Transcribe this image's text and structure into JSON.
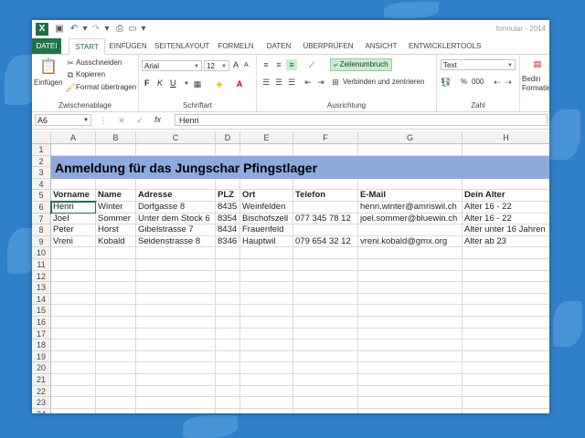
{
  "app": {
    "window_title": "formular - 2014",
    "tabs": [
      "DATEI",
      "START",
      "EINFÜGEN",
      "SEITENLAYOUT",
      "FORMELN",
      "DATEN",
      "ÜBERPRÜFEN",
      "ANSICHT",
      "ENTWICKLERTOOLS"
    ],
    "active_tab": "START"
  },
  "ribbon": {
    "clipboard": {
      "paste": "Einfügen",
      "cut": "Ausschneiden",
      "copy": "Kopieren",
      "format_painter": "Format übertragen",
      "label": "Zwischenablage"
    },
    "font": {
      "font_name": "Arial",
      "font_size": "12",
      "grow": "A",
      "shrink": "A",
      "bold": "F",
      "italic": "K",
      "underline": "U",
      "label": "Schriftart"
    },
    "alignment": {
      "wrap_text": "Zeilenumbruch",
      "merge_center": "Verbinden und zentrieren",
      "label": "Ausrichtung"
    },
    "number": {
      "format": "Text",
      "percent": "%",
      "thousands": "000",
      "label": "Zahl"
    },
    "styles": {
      "conditional": "Bedin",
      "conditional2": "Formatie"
    }
  },
  "formula_bar": {
    "name_box": "A6",
    "fx": "fx",
    "content": "Henri"
  },
  "sheet": {
    "columns": [
      "A",
      "B",
      "C",
      "D",
      "E",
      "F",
      "G",
      "H"
    ],
    "row_numbers": [
      "1",
      "2",
      "3",
      "4",
      "5",
      "6",
      "7",
      "8",
      "9",
      "10",
      "11",
      "12",
      "13",
      "14",
      "15",
      "16",
      "17",
      "18",
      "19",
      "20",
      "21",
      "22",
      "23",
      "24"
    ],
    "title": "Anmeldung für das Jungschar Pfingstlager",
    "headers": [
      "Vorname",
      "Name",
      "Adresse",
      "PLZ",
      "Ort",
      "Telefon",
      "E-Mail",
      "Dein Alter"
    ],
    "rows": [
      [
        "Henri",
        "Winter",
        "Dorfgasse 8",
        "8435",
        "Weinfelden",
        "",
        "henri.winter@amriswil.ch",
        "Alter 16 - 22"
      ],
      [
        "Joel",
        "Sommer",
        "Unter dem Stock 6",
        "8354",
        "Bischofszell",
        "077 345 78 12",
        "joel.sommer@bluewin.ch",
        "Alter 16 - 22"
      ],
      [
        "Peter",
        "Horst",
        "Gibelstrasse 7",
        "8434",
        "Frauenfeld",
        "",
        "",
        "Alter unter 16 Jahren"
      ],
      [
        "Vreni",
        "Kobald",
        "Seidenstrasse 8",
        "8346",
        "Hauptwil",
        "079 654 32 12",
        "vreni.kobald@gmx.org",
        "Alter ab 23"
      ]
    ],
    "banner_color": "#8ea9db",
    "accent_color": "#217346"
  }
}
